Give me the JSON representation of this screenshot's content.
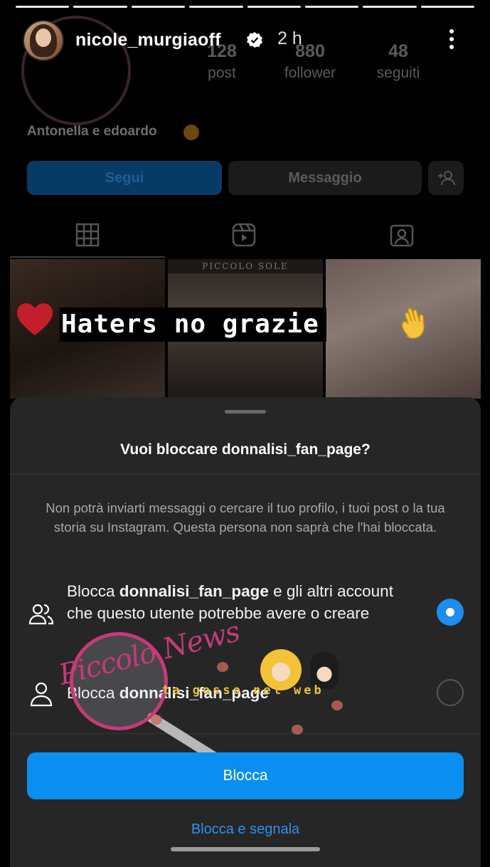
{
  "story": {
    "username": "nicole_murgiaoff",
    "time": "2 h",
    "progress_bars": 8
  },
  "profile": {
    "stats": [
      {
        "value": "128",
        "label": "post"
      },
      {
        "value": "880",
        "label": "follower"
      },
      {
        "value": "48",
        "label": "seguiti"
      }
    ],
    "bio": "Antonella e edoardo",
    "follow_label": "Segui",
    "message_label": "Messaggio",
    "grid_overlay_text": "PICCOLO SOLE"
  },
  "sticker": {
    "text": "Haters no grazie"
  },
  "sheet": {
    "title": "Vuoi bloccare donnalisi_fan_page?",
    "description": "Non potrà inviarti messaggi o cercare il tuo profilo, i tuoi post o la tua storia su Instagram. Questa persona non saprà che l'hai bloccata.",
    "option1": {
      "prefix": "Blocca ",
      "bold": "donnalisi_fan_page",
      "suffix": " e gli altri account che questo utente potrebbe avere o creare",
      "selected": true
    },
    "option2": {
      "prefix": "Blocca ",
      "bold": "donnalisi_fan_page",
      "selected": false
    },
    "primary_button": "Blocca",
    "secondary_link": "Blocca e segnala"
  },
  "watermark": {
    "script_text": "Piccolo News",
    "web_text": "ta gosso nel web"
  },
  "colors": {
    "accent_blue": "#0a8ef0",
    "sheet_bg": "#262626",
    "link_blue": "#2f8ff0"
  }
}
